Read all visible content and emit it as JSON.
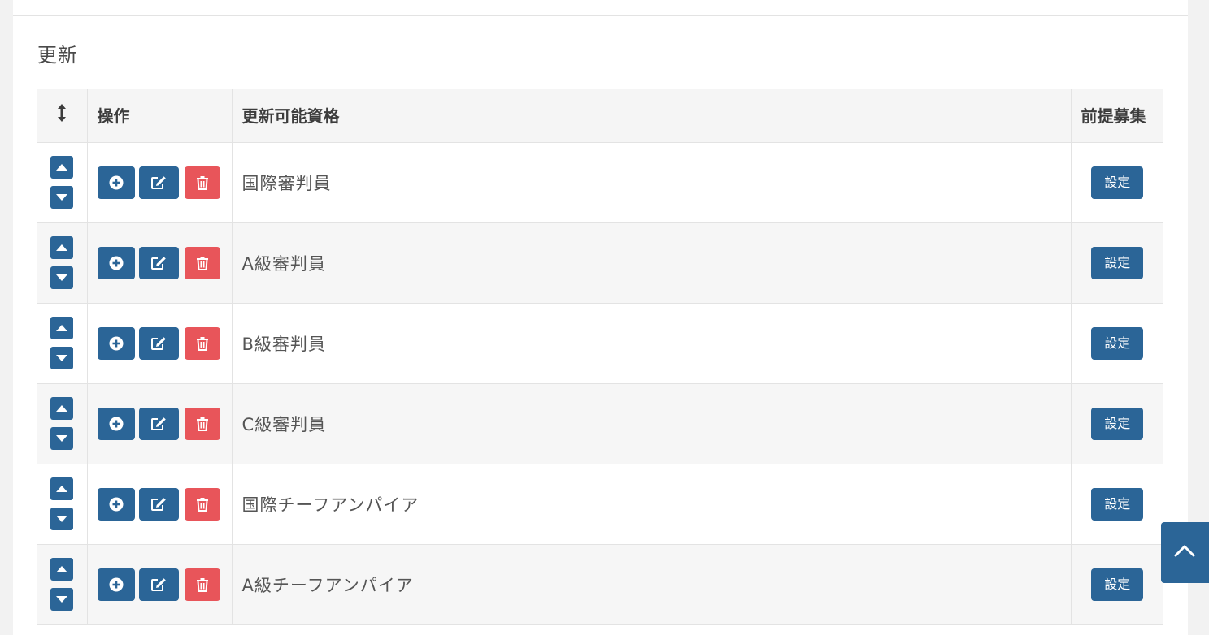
{
  "section": {
    "title": "更新"
  },
  "table": {
    "headers": {
      "sort_icon": "vertical-arrows-icon",
      "operations": "操作",
      "qualification": "更新可能資格",
      "prerequisite": "前提募集"
    },
    "rows": [
      {
        "name": "国際審判員",
        "setting_label": "設定"
      },
      {
        "name": "A級審判員",
        "setting_label": "設定"
      },
      {
        "name": "B級審判員",
        "setting_label": "設定"
      },
      {
        "name": "C級審判員",
        "setting_label": "設定"
      },
      {
        "name": "国際チーフアンパイア",
        "setting_label": "設定"
      },
      {
        "name": "A級チーフアンパイア",
        "setting_label": "設定"
      }
    ]
  },
  "colors": {
    "primary": "#2b6597",
    "danger": "#e8555a"
  }
}
